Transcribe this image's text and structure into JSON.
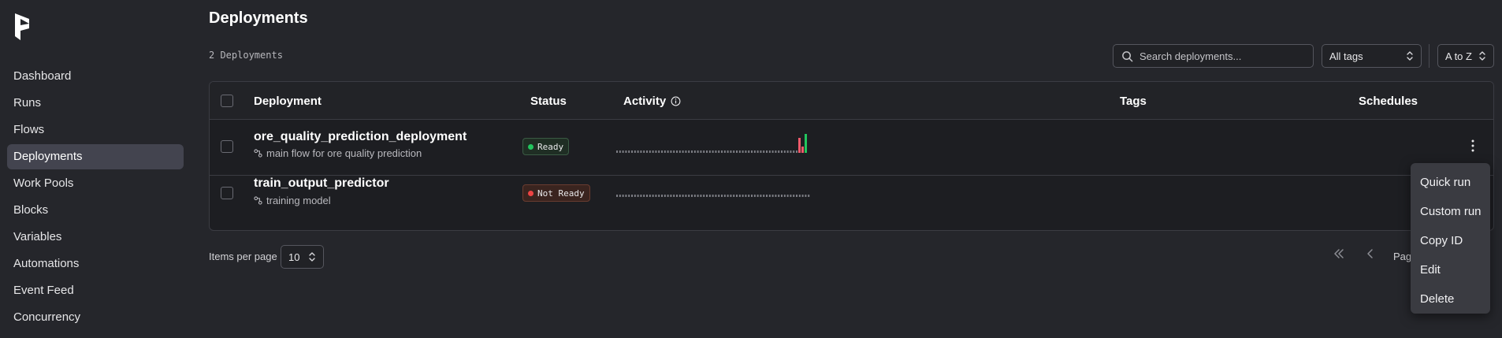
{
  "sidebar": {
    "items": [
      {
        "label": "Dashboard"
      },
      {
        "label": "Runs"
      },
      {
        "label": "Flows"
      },
      {
        "label": "Deployments",
        "active": true
      },
      {
        "label": "Work Pools"
      },
      {
        "label": "Blocks"
      },
      {
        "label": "Variables"
      },
      {
        "label": "Automations"
      },
      {
        "label": "Event Feed"
      },
      {
        "label": "Concurrency"
      }
    ]
  },
  "header": {
    "title": "Deployments",
    "count": "2 Deployments"
  },
  "filters": {
    "search_placeholder": "Search deployments...",
    "tags_value": "All tags",
    "sort_value": "A to Z"
  },
  "table": {
    "columns": {
      "deployment": "Deployment",
      "status": "Status",
      "activity": "Activity",
      "tags": "Tags",
      "schedules": "Schedules"
    },
    "rows": [
      {
        "name": "ore_quality_prediction_deployment",
        "description": "main flow for ore quality prediction",
        "status": "Ready",
        "status_color": "#22c55e"
      },
      {
        "name": "train_output_predictor",
        "description": "training model",
        "status": "Not Ready",
        "status_color": "#ef4444"
      }
    ]
  },
  "pagination": {
    "items_per_page_label": "Items per page",
    "items_per_page_value": "10",
    "page_label": "Pag"
  },
  "row_menu": {
    "items": [
      "Quick run",
      "Custom run",
      "Copy ID",
      "Edit",
      "Delete"
    ]
  },
  "colors": {
    "accent_failed": "#f05a6a",
    "accent_success": "#22c55e"
  },
  "icons": [
    "prefect-logo-icon",
    "search-icon",
    "chevron-updown-icon",
    "info-icon",
    "flow-icon",
    "kebab-menu-icon",
    "first-page-icon",
    "prev-page-icon"
  ]
}
